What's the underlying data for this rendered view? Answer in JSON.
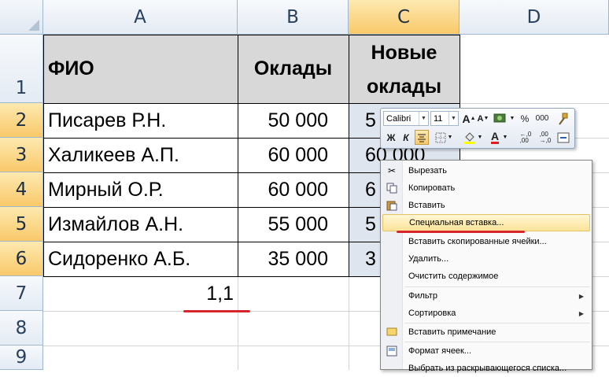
{
  "columns": [
    "A",
    "B",
    "C",
    "D"
  ],
  "rows": [
    "1",
    "2",
    "3",
    "4",
    "5",
    "6",
    "7",
    "8",
    "9"
  ],
  "table": {
    "headers": {
      "fio": "ФИО",
      "salary": "Оклады",
      "new_salary_line1": "Новые",
      "new_salary_line2": "оклады"
    },
    "data": [
      {
        "fio": "Писарев Р.Н.",
        "salary": "50 000",
        "new": "5"
      },
      {
        "fio": "Халикеев А.П.",
        "salary": "60 000",
        "new": "60 000"
      },
      {
        "fio": "Мирный О.Р.",
        "salary": "60 000",
        "new": "6"
      },
      {
        "fio": "Измайлов А.Н.",
        "salary": "55 000",
        "new": "5"
      },
      {
        "fio": "Сидоренко А.Б.",
        "salary": "35 000",
        "new": "3"
      }
    ],
    "coef": "1,1"
  },
  "mini_toolbar": {
    "font_name": "Calibri",
    "font_size": "11",
    "grow_font": "A",
    "shrink_font": "A",
    "percent": "%",
    "thousands": "000",
    "bold": "Ж",
    "italic": "К",
    "font_color_glyph": "A",
    "inc_decimal": "←,0\n,00",
    "dec_decimal": ",00\n→,0"
  },
  "context_menu": {
    "items": [
      {
        "label": "Вырезать",
        "icon": "scissors-icon"
      },
      {
        "label": "Копировать",
        "icon": "copy-icon"
      },
      {
        "label": "Вставить",
        "icon": "paste-icon"
      },
      {
        "label": "Специальная вставка...",
        "icon": ""
      },
      {
        "label": "Вставить скопированные ячейки...",
        "icon": ""
      },
      {
        "label": "Удалить...",
        "icon": ""
      },
      {
        "label": "Очистить содержимое",
        "icon": ""
      },
      {
        "label": "Фильтр",
        "icon": "",
        "submenu": true
      },
      {
        "label": "Сортировка",
        "icon": "",
        "submenu": true
      },
      {
        "label": "Вставить примечание",
        "icon": "comment-icon"
      },
      {
        "label": "Формат ячеек...",
        "icon": "format-cells-icon"
      },
      {
        "label": "Выбрать из раскрывающегося списка...",
        "icon": ""
      }
    ]
  },
  "colors": {
    "selection_header": "#f9c96a",
    "header_fill": "#d8d8d8",
    "red_mark": "#d6262b",
    "menu_highlight": "#fde39a"
  }
}
